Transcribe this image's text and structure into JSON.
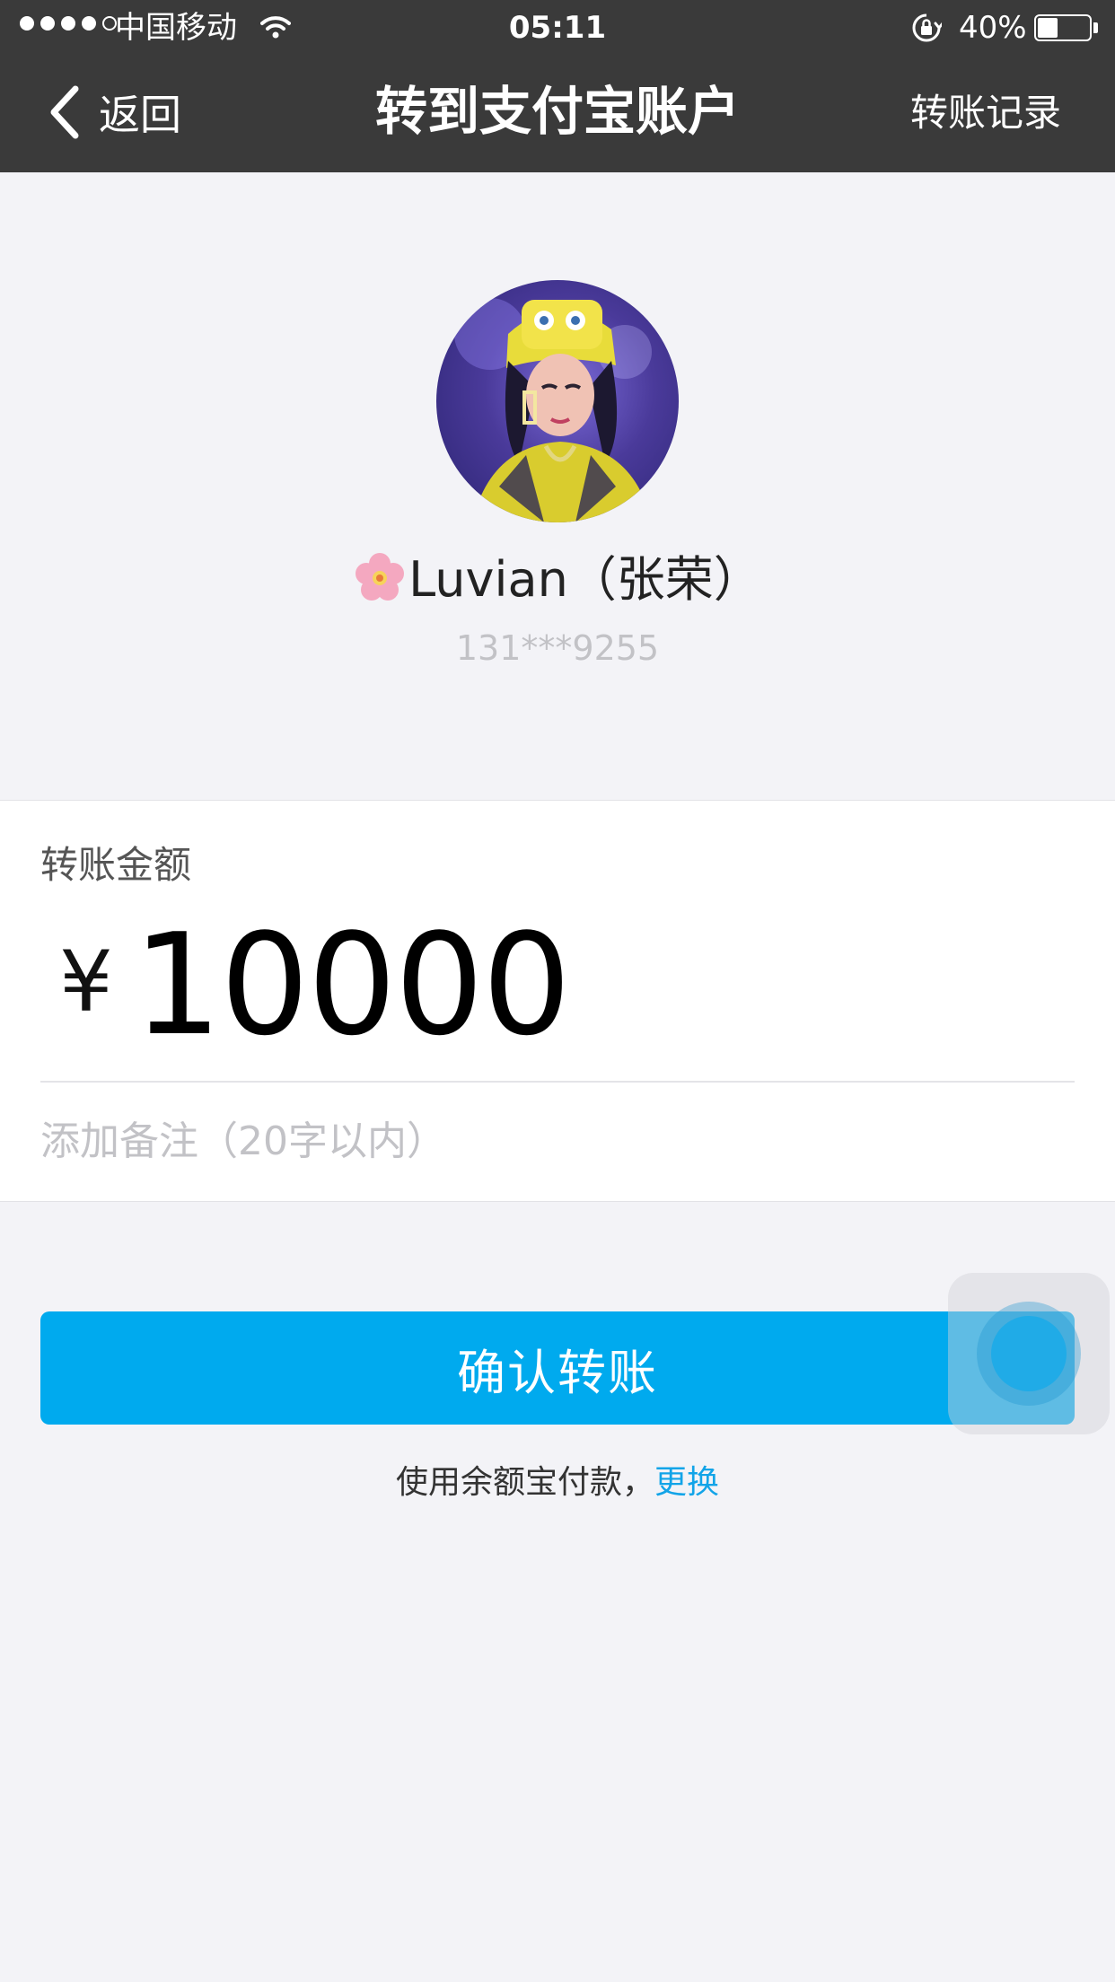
{
  "status_bar": {
    "carrier": "中国移动",
    "time": "05:11",
    "battery_percent": "40%",
    "battery_level": 0.4,
    "signal_bars_filled": 4,
    "signal_bars_total": 5
  },
  "nav": {
    "back_label": "返回",
    "title": "转到支付宝账户",
    "right_label": "转账记录"
  },
  "recipient": {
    "display_name": "Luvian（张荣）",
    "phone": "131***9255",
    "name_emoji": "flower"
  },
  "transfer": {
    "amount_label": "转账金额",
    "currency_symbol": "¥",
    "amount": "10000",
    "remark_placeholder": "添加备注（20字以内）"
  },
  "actions": {
    "confirm_label": "确认转账",
    "payment_prefix": "使用余额宝付款，",
    "change_label": "更换"
  },
  "colors": {
    "nav_background": "#3a3a3a",
    "page_background": "#f3f3f7",
    "primary_button": "#00aaee",
    "link": "#12a4e8"
  }
}
